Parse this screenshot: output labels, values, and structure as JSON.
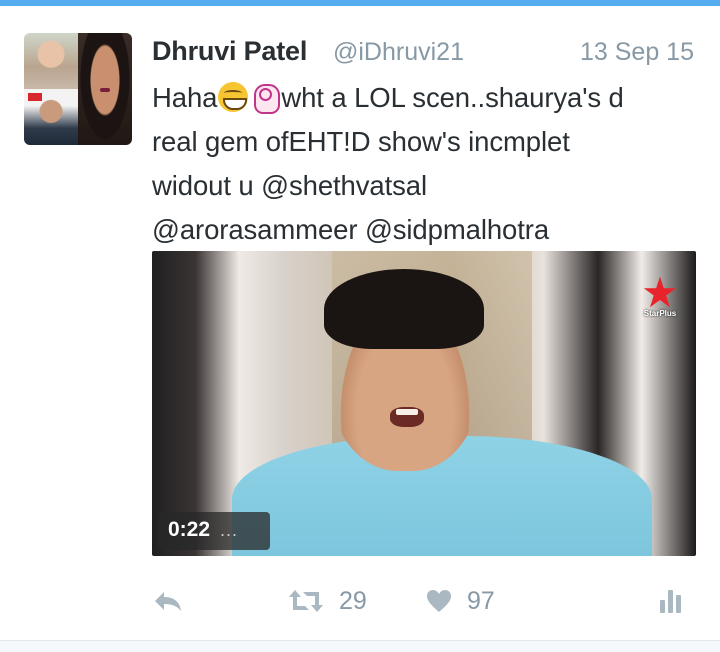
{
  "tweet": {
    "author_name": "Dhruvi Patel",
    "handle": "@iDhruvi21",
    "date": "13 Sep 15",
    "text_lines": [
      {
        "before": "Haha",
        "after": "wht a LOL scen..shaurya's d"
      },
      "real gem ofEHT!D show's incmplet",
      "widout u @shethvatsal",
      "@arorasammeer @sidpmalhotra"
    ],
    "emojis": [
      "grinning-face-icon",
      "ok-hand-icon"
    ],
    "media": {
      "duration": "0:22",
      "dots": "...",
      "channel_logo_text": "StarPlus"
    },
    "actions": {
      "retweets": "29",
      "likes": "97"
    }
  },
  "colors": {
    "accent": "#55acee",
    "text": "#292f33",
    "muted": "#8899a6",
    "icon": "#aab8c2"
  }
}
